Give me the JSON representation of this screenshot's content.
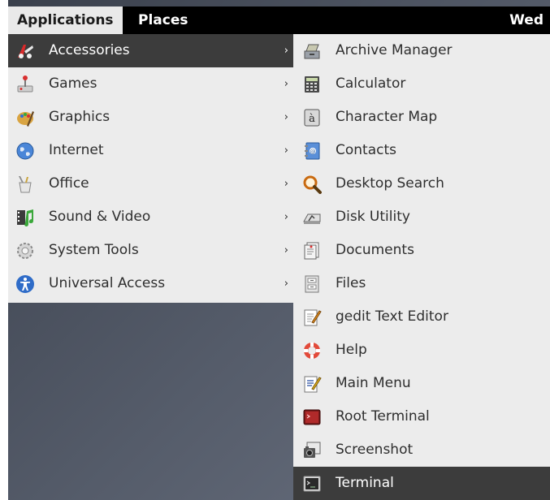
{
  "topbar": {
    "applications_label": "Applications",
    "places_label": "Places",
    "clock_text": "Wed"
  },
  "menu": {
    "categories": [
      {
        "label": "Accessories",
        "icon": "accessories-icon",
        "selected": true
      },
      {
        "label": "Games",
        "icon": "games-icon"
      },
      {
        "label": "Graphics",
        "icon": "graphics-icon"
      },
      {
        "label": "Internet",
        "icon": "internet-icon"
      },
      {
        "label": "Office",
        "icon": "office-icon"
      },
      {
        "label": "Sound & Video",
        "icon": "sound-video-icon"
      },
      {
        "label": "System Tools",
        "icon": "system-tools-icon"
      },
      {
        "label": "Universal Access",
        "icon": "universal-access-icon"
      }
    ],
    "arrow_glyph": "›"
  },
  "submenu": {
    "items": [
      {
        "label": "Archive Manager",
        "icon": "archive-manager-icon"
      },
      {
        "label": "Calculator",
        "icon": "calculator-icon"
      },
      {
        "label": "Character Map",
        "icon": "character-map-icon",
        "glyph": "à"
      },
      {
        "label": "Contacts",
        "icon": "contacts-icon"
      },
      {
        "label": "Desktop Search",
        "icon": "desktop-search-icon"
      },
      {
        "label": "Disk Utility",
        "icon": "disk-utility-icon"
      },
      {
        "label": "Documents",
        "icon": "documents-icon"
      },
      {
        "label": "Files",
        "icon": "files-icon"
      },
      {
        "label": "gedit Text Editor",
        "icon": "gedit-text-editor-icon"
      },
      {
        "label": "Help",
        "icon": "help-icon"
      },
      {
        "label": "Main Menu",
        "icon": "main-menu-icon"
      },
      {
        "label": "Root Terminal",
        "icon": "root-terminal-icon"
      },
      {
        "label": "Screenshot",
        "icon": "screenshot-icon"
      },
      {
        "label": "Terminal",
        "icon": "terminal-icon",
        "selected": true
      }
    ]
  },
  "colors": {
    "menu_bg": "#ececec",
    "selected_bg": "#3c3c3c",
    "topbar_bg": "#000000",
    "desktop_bg": "#4a505c"
  }
}
